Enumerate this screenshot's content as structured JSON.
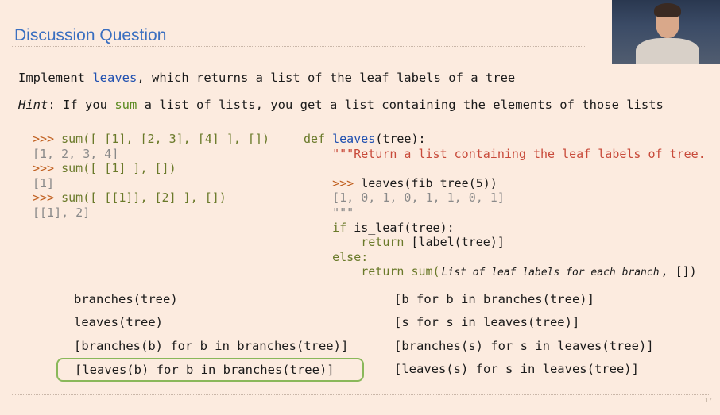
{
  "slide": {
    "title": "Discussion Question",
    "page_number": "17",
    "intro": {
      "pre": "Implement ",
      "fn": "leaves",
      "post": ", which returns a list of the leaf labels of a tree"
    },
    "hint": {
      "label": "Hint",
      "pre": ": If you ",
      "fn": "sum",
      "post": " a list of lists, you get a list containing the elements of those lists"
    }
  },
  "examples": {
    "prompt": ">>> ",
    "line1": "sum([ [1], [2, 3], [4] ], [])",
    "out1": "[1, 2, 3, 4]",
    "line2": "sum([ [1] ], [])",
    "out2": "[1]",
    "line3": "sum([ [[1]], [2] ], [])",
    "out3": "[[1], 2]"
  },
  "definition": {
    "def_kw": "def",
    "name": "leaves",
    "params": "(tree):",
    "docstring": "\"\"\"Return a list containing the leaf labels of tree.",
    "doctest_call": "leaves(fib_tree(5))",
    "doctest_out": "[1, 0, 1, 0, 1, 1, 0, 1]",
    "doc_close": "\"\"\"",
    "if_kw": "if",
    "if_cond": " is_leaf(tree):",
    "return_kw": "return",
    "return_leaf": " [label(tree)]",
    "else_kw": "else:",
    "return_sum": "sum(",
    "blank_label": "List of leaf labels for each branch",
    "return_tail": ", [])"
  },
  "options": {
    "a": "branches(tree)",
    "b": "leaves(tree)",
    "c": "[branches(b) for b in branches(tree)]",
    "d": "[leaves(b) for b in branches(tree)]",
    "e": "[b for b in branches(tree)]",
    "f": "[s for s in leaves(tree)]",
    "g": "[branches(s) for s in leaves(tree)]",
    "h": "[leaves(s) for s in leaves(tree)]",
    "selected": "d",
    "selected_color": "#8ab85a"
  },
  "colors": {
    "title": "#3a6fc0",
    "background": "#fcebdf"
  }
}
